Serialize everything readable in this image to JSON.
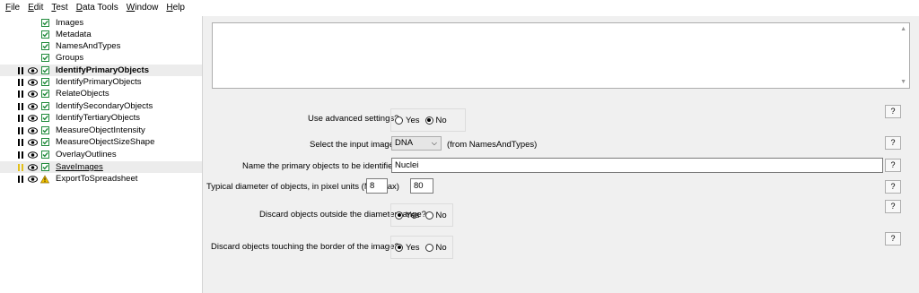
{
  "menu": {
    "file": {
      "mnemonic": "F",
      "rest": "ile"
    },
    "edit": {
      "mnemonic": "E",
      "rest": "dit"
    },
    "test": {
      "mnemonic": "T",
      "rest": "est"
    },
    "data_tools": {
      "mnemonic": "D",
      "rest": "ata Tools"
    },
    "window": {
      "mnemonic": "W",
      "rest": "indow"
    },
    "help": {
      "mnemonic": "H",
      "rest": "elp"
    }
  },
  "pipeline": {
    "input_modules": [
      "Images",
      "Metadata",
      "NamesAndTypes",
      "Groups"
    ],
    "modules": [
      "IdentifyPrimaryObjects",
      "IdentifyPrimaryObjects",
      "RelateObjects",
      "IdentifySecondaryObjects",
      "IdentifyTertiaryObjects",
      "MeasureObjectIntensity",
      "MeasureObjectSizeShape",
      "OverlayOutlines",
      "SaveImages",
      "ExportToSpreadsheet"
    ]
  },
  "settings": {
    "advanced_label": "Use advanced settings?",
    "input_image_label": "Select the input image",
    "input_image_value": "DNA",
    "input_image_source": "(from NamesAndTypes)",
    "objects_name_label": "Name the primary objects to be identified",
    "objects_name_value": "Nuclei",
    "diameter_label": "Typical diameter of objects, in pixel units (Min,Max)",
    "diameter_min": "8",
    "diameter_max": "80",
    "discard_outside_label": "Discard objects outside the diameter range?",
    "discard_border_label": "Discard objects touching the border of the image?",
    "yes": "Yes",
    "no": "No",
    "help": "?"
  },
  "colors": {
    "check": "#1f8a3a",
    "warning": "#f2c200",
    "pause_active": "#e3c01a"
  }
}
